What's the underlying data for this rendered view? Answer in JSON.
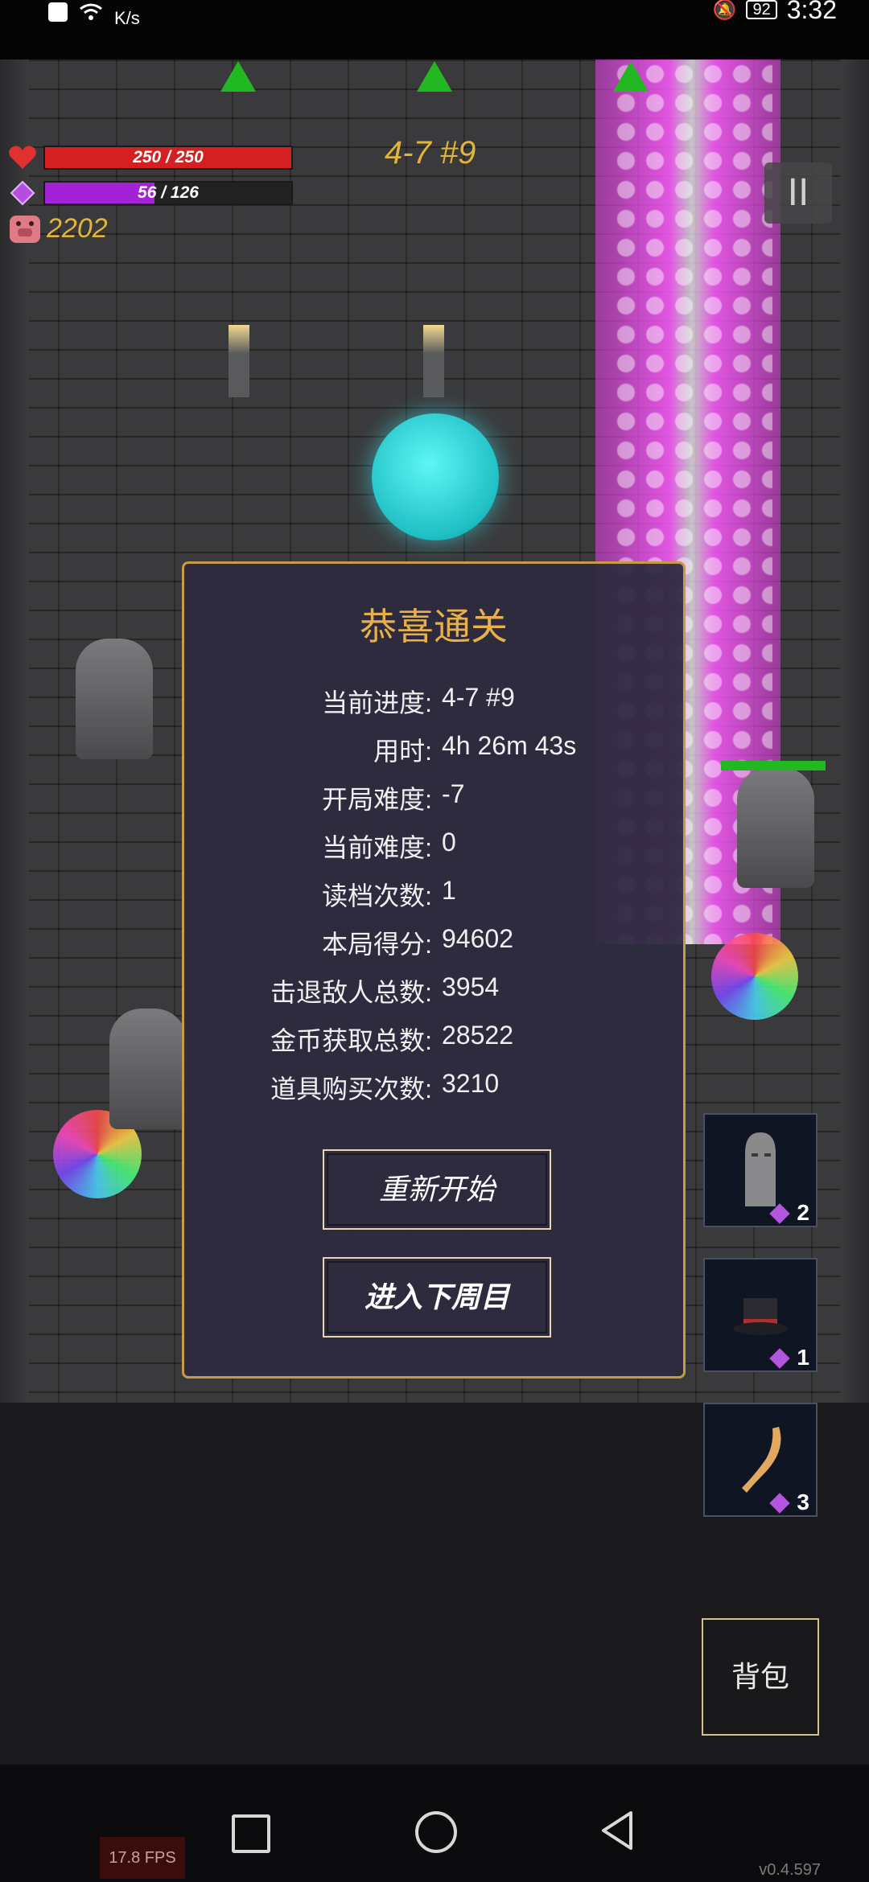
{
  "status_bar": {
    "speed_unit": "K/s",
    "battery": "92",
    "time": "3:32"
  },
  "hud": {
    "hp": {
      "text": "250 / 250",
      "value": 250,
      "max": 250,
      "color": "#d42020"
    },
    "mp": {
      "text": "56 / 126",
      "value": 56,
      "max": 126,
      "color": "#a422d6"
    },
    "coins": "2202",
    "level": "4-7 #9",
    "pause_label": "II"
  },
  "dialog": {
    "title": "恭喜通关",
    "stats": [
      {
        "label": "当前进度:",
        "value": "4-7 #9"
      },
      {
        "label": "用时:",
        "value": "4h 26m 43s"
      },
      {
        "label": "开局难度:",
        "value": "-7"
      },
      {
        "label": "当前难度:",
        "value": "0"
      },
      {
        "label": "读档次数:",
        "value": "1"
      },
      {
        "label": "本局得分:",
        "value": "94602"
      },
      {
        "label": "击退敌人总数:",
        "value": "3954"
      },
      {
        "label": "金币获取总数:",
        "value": "28522"
      },
      {
        "label": "道具购买次数:",
        "value": "3210"
      }
    ],
    "restart_label": "重新开始",
    "next_cycle_label": "进入下周目"
  },
  "items": [
    {
      "icon": "statue-icon",
      "count": "2"
    },
    {
      "icon": "hat-icon",
      "count": "1"
    },
    {
      "icon": "horn-icon",
      "count": "3"
    }
  ],
  "bag_label": "背包",
  "fps": "17.8 FPS",
  "version": "v0.4.597",
  "colors": {
    "accent_gold": "#e2b43a",
    "dialog_border": "#c79a48",
    "beam": "#ff5aff"
  }
}
